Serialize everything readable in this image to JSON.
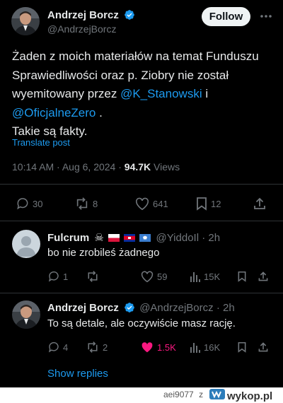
{
  "main_post": {
    "author_name": "Andrzej Borcz",
    "handle": "@AndrzejBorcz",
    "follow_label": "Follow",
    "more_label": "···",
    "text_line1": "Żaden z moich materiałów na temat Funduszu",
    "text_line2": "Sprawiedliwości oraz p. Ziobry nie został",
    "text_line3_pre": "wyemitowany przez ",
    "mention1": "@K_Stanowski",
    "text_line3_post": " i",
    "mention2": "@OficjalneZero",
    "text_line4_post": " .",
    "text_line5": "Takie są fakty.",
    "translate_label": "Translate post",
    "time": "10:14 AM",
    "date": "Aug 6, 2024",
    "views_count": "94.7K",
    "views_label": "Views",
    "replies": "30",
    "reposts": "8",
    "likes": "641",
    "bookmarks": "12"
  },
  "reply1": {
    "author_name": "Fulcrum",
    "emoji_skull": "☠",
    "handle": "@YiddoIl",
    "time": "2h",
    "text": "bo nie zrobileś żadnego",
    "replies": "1",
    "reposts": "",
    "likes": "59",
    "views": "15K"
  },
  "reply2": {
    "author_name": "Andrzej Borcz",
    "handle": "@AndrzejBorcz",
    "time": "2h",
    "text": "To są detale, ale oczywiście masz rację.",
    "replies": "4",
    "reposts": "2",
    "likes": "1.5K",
    "views": "16K",
    "show_replies_label": "Show replies"
  },
  "footer": {
    "username": "aei9077",
    "separator": "z",
    "logo_text": "wykop.pl"
  },
  "colors": {
    "background": "#000000",
    "text": "#e7e9ea",
    "muted": "#71767b",
    "accent": "#1d9bf0",
    "like_active": "#f91880",
    "verified": "#1d9bf0"
  }
}
